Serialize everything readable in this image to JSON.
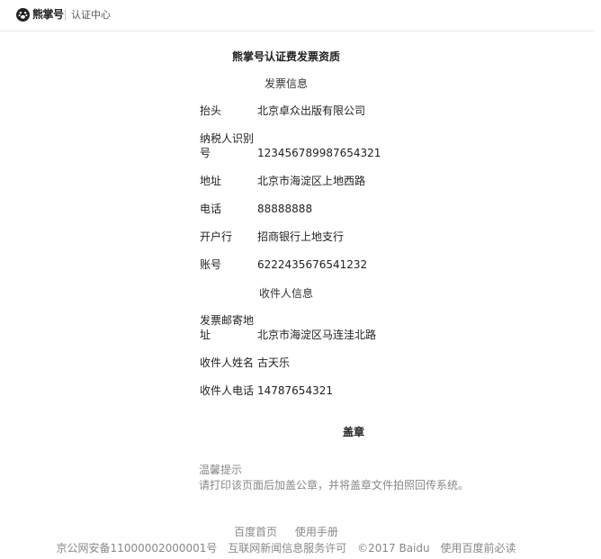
{
  "header": {
    "logo_icon": "paw-icon",
    "brand": "熊掌号",
    "subtitle": "认证中心"
  },
  "page_title": "熊掌号认证费发票资质",
  "invoice_section": {
    "heading": "发票信息",
    "rows": [
      {
        "label": "抬头",
        "value": "北京卓众出版有限公司"
      },
      {
        "label": "纳税人识别号",
        "value": "123456789987654321"
      },
      {
        "label": "地址",
        "value": "北京市海淀区上地西路"
      },
      {
        "label": "电话",
        "value": "88888888"
      },
      {
        "label": "开户行",
        "value": "招商银行上地支行"
      },
      {
        "label": "账号",
        "value": "6222435676541232"
      }
    ]
  },
  "recipient_section": {
    "heading": "收件人信息",
    "rows": [
      {
        "label": "发票邮寄地址",
        "value": "北京市海淀区马连洼北路"
      },
      {
        "label": "收件人姓名",
        "value": "古天乐"
      },
      {
        "label": "收件人电话",
        "value": "14787654321"
      }
    ]
  },
  "stamp_label": "盖章",
  "tips": {
    "title": "温馨提示",
    "text": "请打印该页面后加盖公章，并将盖章文件拍照回传系统。"
  },
  "footer": {
    "links": [
      "百度首页",
      "使用手册"
    ],
    "copyright": [
      "京公网安备11000002000001号",
      "互联网新闻信息服务许可",
      "©2017 Baidu",
      "使用百度前必读"
    ]
  }
}
